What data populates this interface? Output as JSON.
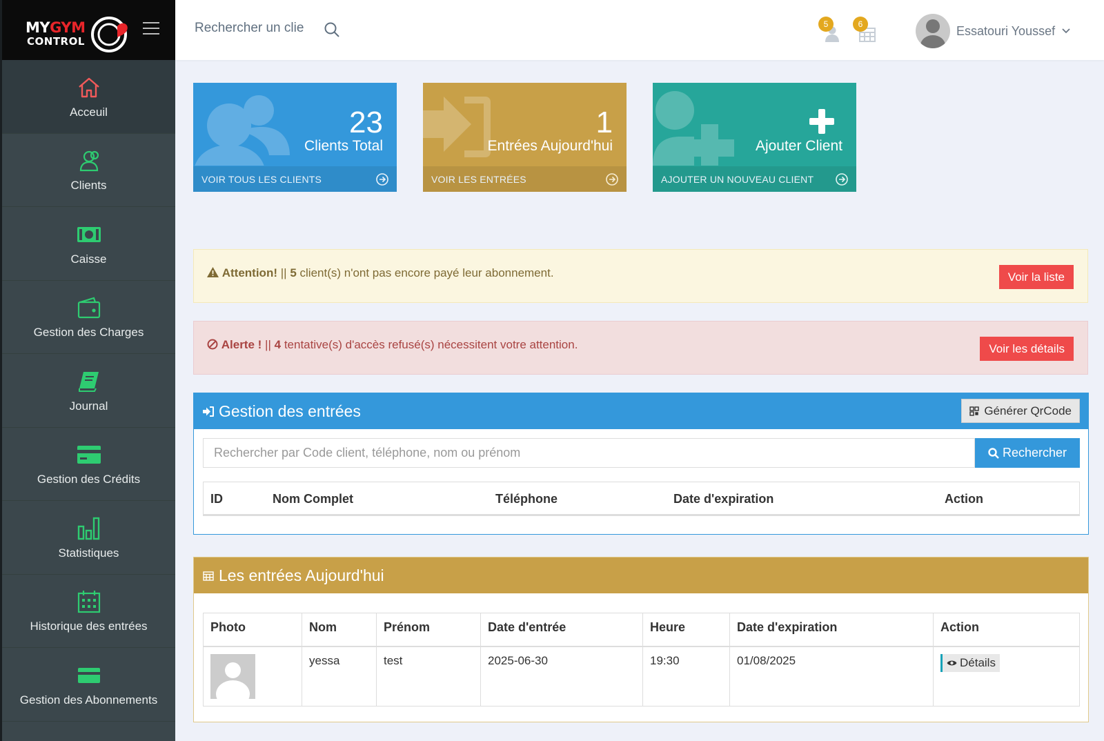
{
  "brand": {
    "line1_white": "MY",
    "line1_red": "GYM",
    "line2": "CONTROL"
  },
  "sidebar": {
    "items": [
      {
        "label": "Acceuil",
        "icon": "home-icon"
      },
      {
        "label": "Clients",
        "icon": "users-icon"
      },
      {
        "label": "Caisse",
        "icon": "money-icon"
      },
      {
        "label": "Gestion des Charges",
        "icon": "wallet-icon"
      },
      {
        "label": "Journal",
        "icon": "book-icon"
      },
      {
        "label": "Gestion des Crédits",
        "icon": "credit-card-icon"
      },
      {
        "label": "Statistiques",
        "icon": "bar-chart-icon"
      },
      {
        "label": "Historique des entrées",
        "icon": "calendar-icon"
      },
      {
        "label": "Gestion des Abonnements",
        "icon": "card-icon"
      }
    ]
  },
  "topbar": {
    "search_value": "Rechercher un clie",
    "notif_clients_count": "5",
    "notif_calendar_count": "6",
    "user_name": "Essatouri Youssef"
  },
  "tiles": [
    {
      "number": "23",
      "caption": "Clients Total",
      "footer": "VOIR TOUS LES CLIENTS",
      "color": "#3498db"
    },
    {
      "number": "1",
      "caption": "Entrées Aujourd'hui",
      "footer": "VOIR LES ENTRÉES",
      "color": "#c8a048"
    },
    {
      "number": "",
      "caption": "Ajouter Client",
      "footer": "AJOUTER UN NOUVEAU CLIENT",
      "color": "#26a69a"
    }
  ],
  "alerts": {
    "warning": {
      "title": "Attention!",
      "sep": "||",
      "count": "5",
      "text": "client(s) n'ont pas encore payé leur abonnement.",
      "button": "Voir la liste"
    },
    "danger": {
      "title": "Alerte !",
      "sep": "||",
      "count": "4",
      "text": "tentative(s) d'accès refusé(s) nécessitent votre attention.",
      "button": "Voir les détails"
    }
  },
  "entries_panel": {
    "title": "Gestion des entrées",
    "qr_button": "Générer QrCode",
    "search_placeholder": "Rechercher par Code client, téléphone, nom ou prénom",
    "search_button": "Rechercher",
    "columns": [
      "ID",
      "Nom Complet",
      "Téléphone",
      "Date d'expiration",
      "Action"
    ]
  },
  "today_panel": {
    "title": "Les entrées Aujourd'hui",
    "columns": [
      "Photo",
      "Nom",
      "Prénom",
      "Date d'entrée",
      "Heure",
      "Date d'expiration",
      "Action"
    ],
    "rows": [
      {
        "nom": "yessa",
        "prenom": "test",
        "date_entree": "2025-06-30",
        "heure": "19:30",
        "date_expiration": "01/08/2025",
        "action": "Détails"
      }
    ]
  },
  "colors": {
    "sidebar": "#3b474c",
    "accent_red": "#ef4a4a",
    "blue": "#3498db",
    "gold": "#c8a048",
    "teal": "#26a69a",
    "icon_green": "#2ecc71"
  }
}
